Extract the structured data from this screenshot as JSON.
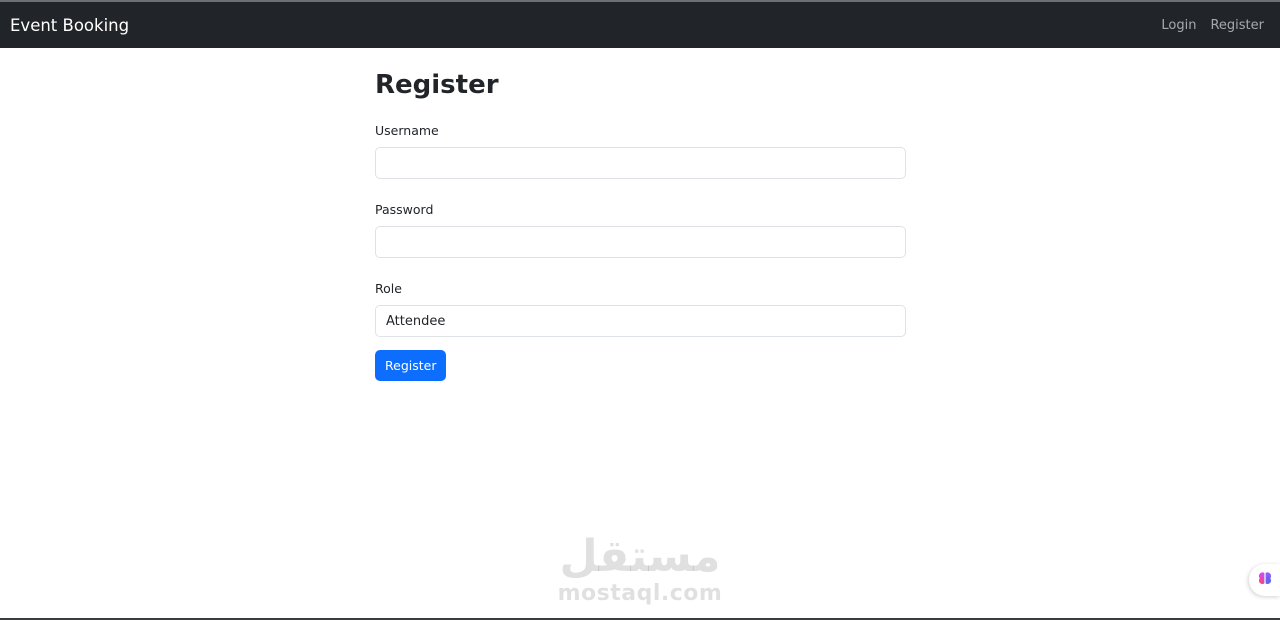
{
  "navbar": {
    "brand": "Event Booking",
    "links": [
      "Login",
      "Register"
    ]
  },
  "page": {
    "title": "Register"
  },
  "form": {
    "username_label": "Username",
    "username_value": "",
    "password_label": "Password",
    "password_value": "",
    "role_label": "Role",
    "role_selected": "Attendee",
    "submit_label": "Register"
  },
  "watermark": {
    "arabic": "مستقل",
    "latin": "mostaql.com"
  },
  "widget": {
    "icon": "brain-icon"
  },
  "colors": {
    "navbar_bg": "#212529",
    "primary": "#0d6efd"
  }
}
